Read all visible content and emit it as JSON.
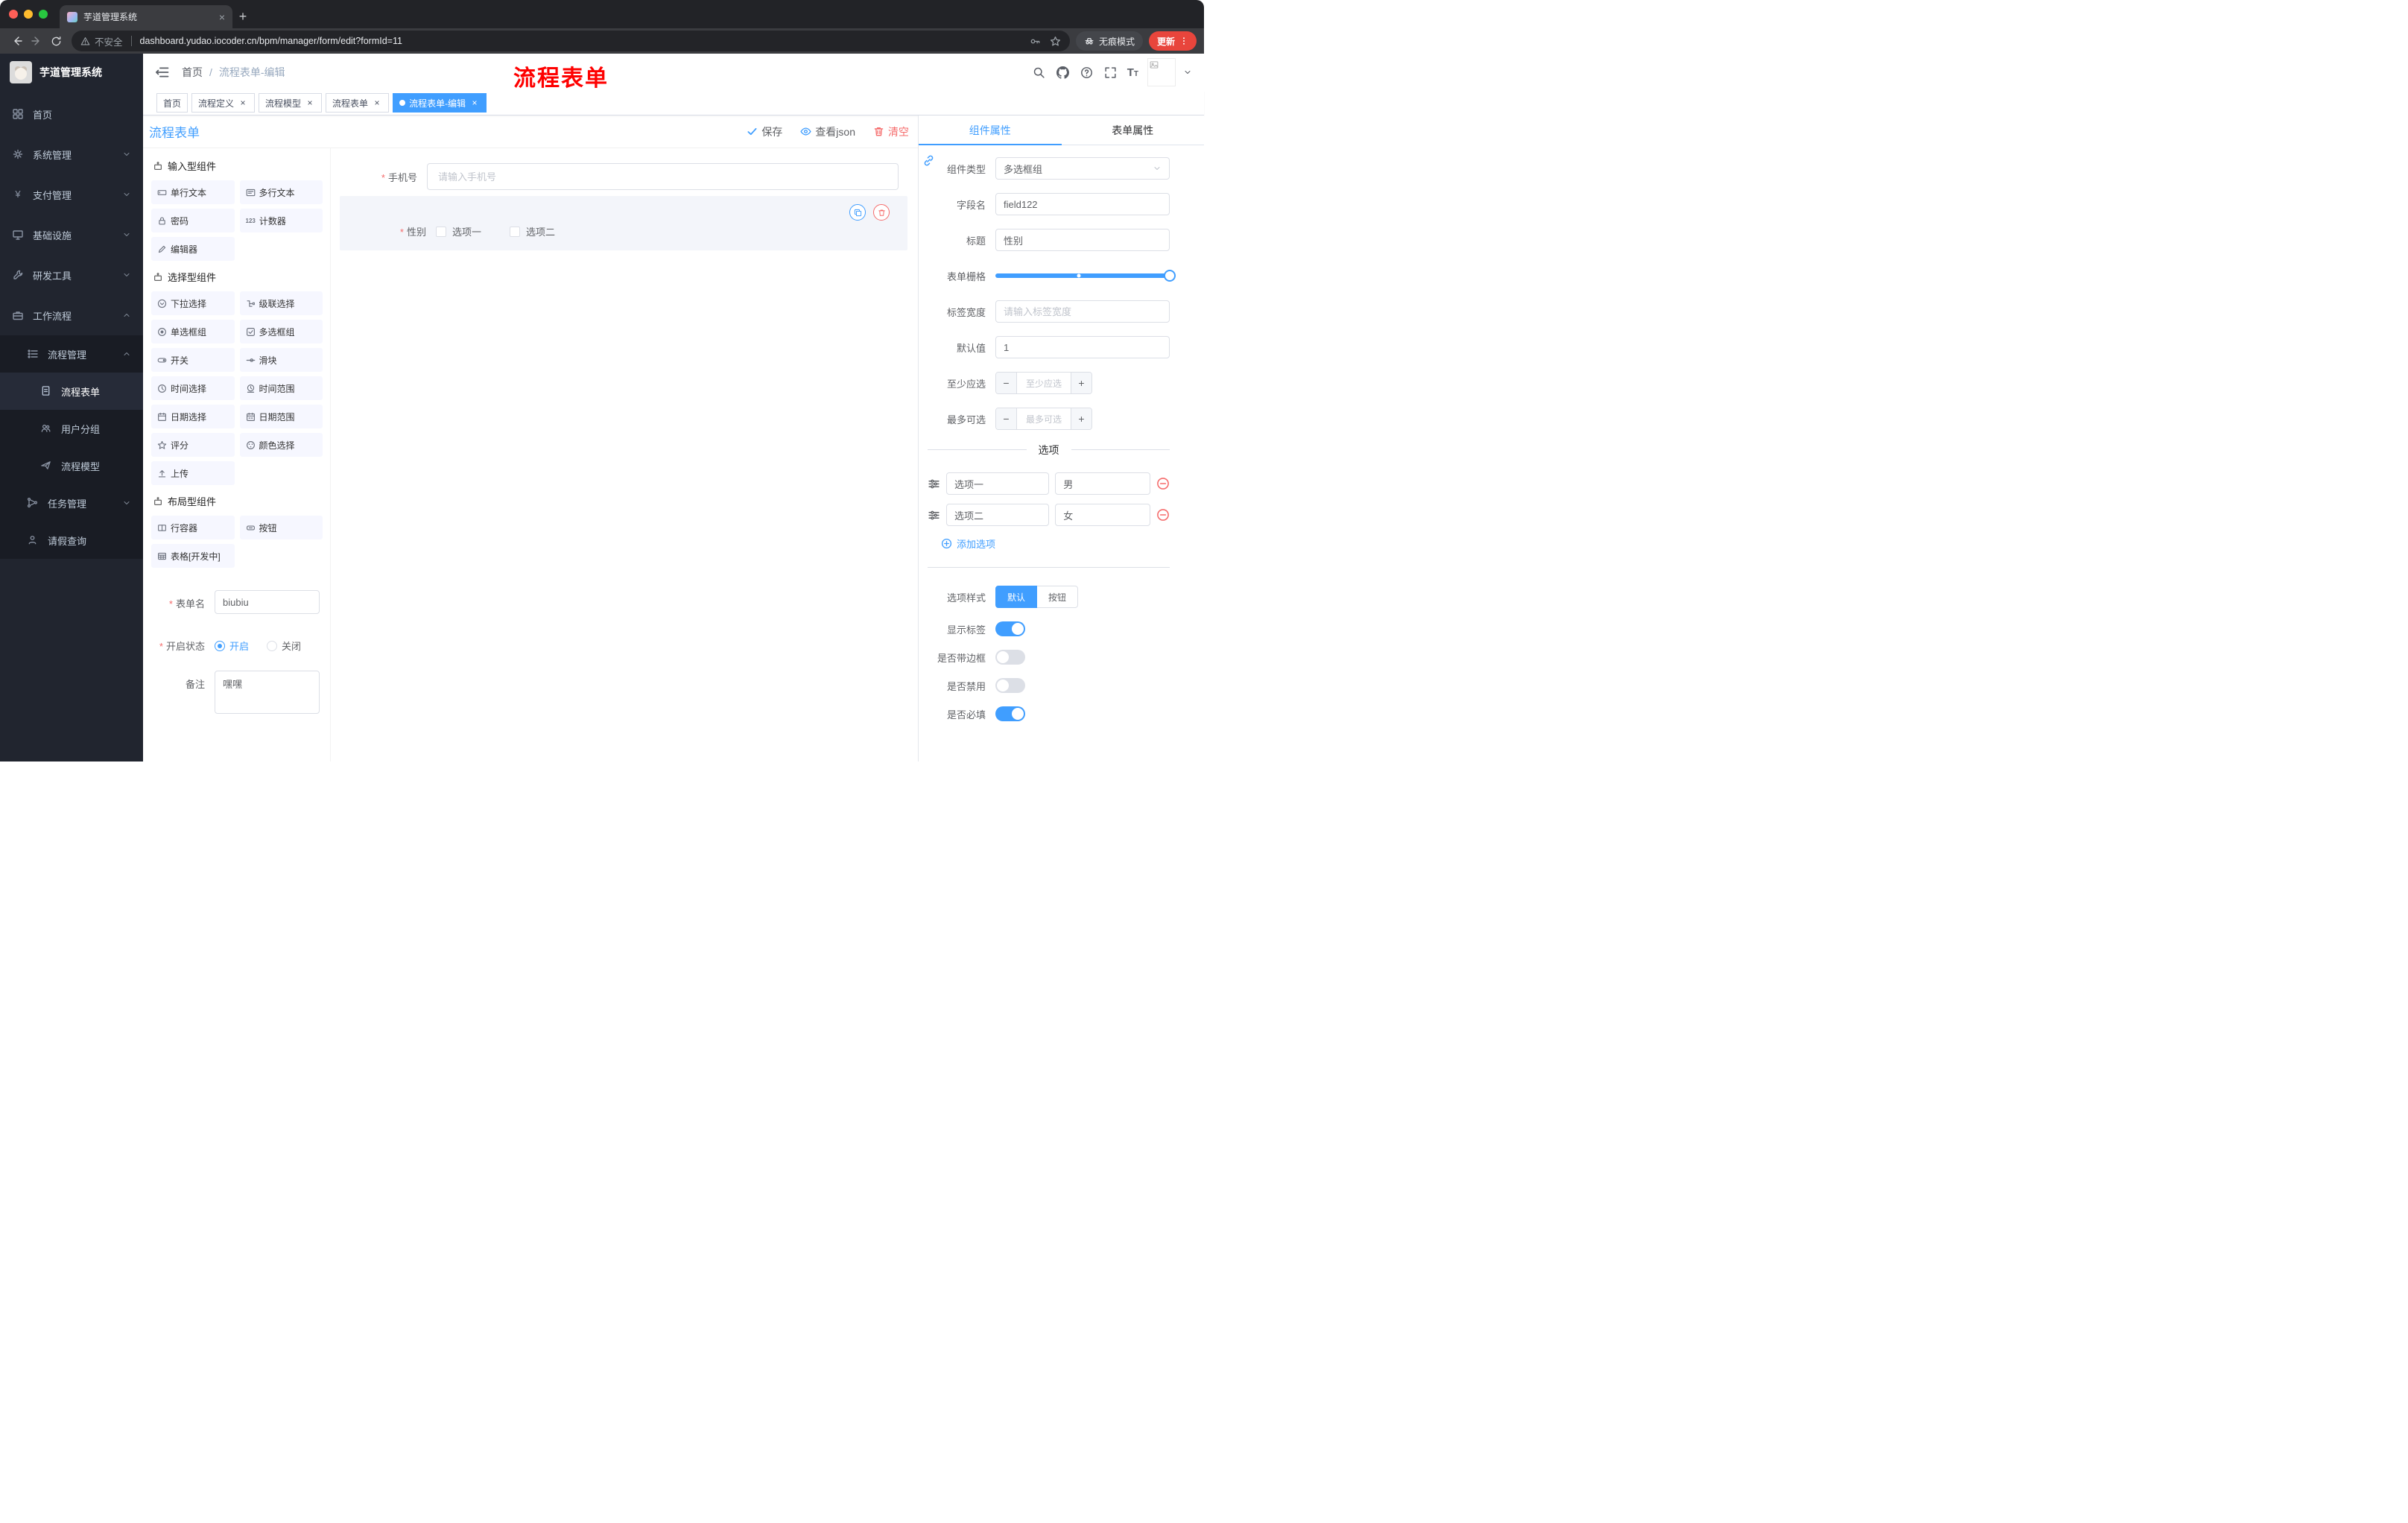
{
  "colors": {
    "accent": "#409eff",
    "danger": "#f56c6c",
    "annotation_red": "#fe0000",
    "active_tag": "#409eff",
    "sidebar_bg": "#21252f",
    "update_chip": "#e8453c"
  },
  "browser": {
    "tab_title": "芋道管理系统",
    "security_label": "不安全",
    "url": "dashboard.yudao.iocoder.cn/bpm/manager/form/edit?formId=11",
    "incognito_label": "无痕模式",
    "update_label": "更新"
  },
  "sidebar": {
    "logo_title": "芋道管理系统",
    "items": [
      {
        "label": "首页"
      },
      {
        "label": "系统管理"
      },
      {
        "label": "支付管理"
      },
      {
        "label": "基础设施"
      },
      {
        "label": "研发工具"
      },
      {
        "label": "工作流程"
      },
      {
        "label": "流程管理"
      },
      {
        "label": "流程表单"
      },
      {
        "label": "用户分组"
      },
      {
        "label": "流程模型"
      },
      {
        "label": "任务管理"
      },
      {
        "label": "请假查询"
      }
    ]
  },
  "navbar": {
    "breadcrumb_home": "首页",
    "breadcrumb_current": "流程表单-编辑",
    "annotation": "流程表单"
  },
  "tags": [
    {
      "label": "首页"
    },
    {
      "label": "流程定义"
    },
    {
      "label": "流程模型"
    },
    {
      "label": "流程表单"
    },
    {
      "label": "流程表单-编辑"
    }
  ],
  "designer": {
    "title": "流程表单",
    "actions": {
      "save": "保存",
      "view_json": "查看json",
      "clear": "清空"
    },
    "component_groups": [
      {
        "title": "输入型组件",
        "items": [
          "单行文本",
          "多行文本",
          "密码",
          "计数器",
          "编辑器"
        ]
      },
      {
        "title": "选择型组件",
        "items": [
          "下拉选择",
          "级联选择",
          "单选框组",
          "多选框组",
          "开关",
          "滑块",
          "时间选择",
          "时间范围",
          "日期选择",
          "日期范围",
          "评分",
          "颜色选择",
          "上传"
        ]
      },
      {
        "title": "布局型组件",
        "items": [
          "行容器",
          "按钮",
          "表格[开发中]"
        ]
      }
    ],
    "meta_form": {
      "form_name_label": "表单名",
      "form_name_value": "biubiu",
      "status_label": "开启状态",
      "status_on": "开启",
      "status_off": "关闭",
      "remark_label": "备注",
      "remark_value": "嘿嘿"
    },
    "canvas": {
      "phone_label": "手机号",
      "phone_placeholder": "请输入手机号",
      "gender_label": "性别",
      "gender_options": [
        "选项一",
        "选项二"
      ]
    }
  },
  "properties": {
    "tab_component": "组件属性",
    "tab_form": "表单属性",
    "component_type_label": "组件类型",
    "component_type_value": "多选框组",
    "field_name_label": "字段名",
    "field_name_value": "field122",
    "title_label": "标题",
    "title_value": "性别",
    "grid_label": "表单栅格",
    "label_width_label": "标签宽度",
    "label_width_placeholder": "请输入标签宽度",
    "default_label": "默认值",
    "default_value": "1",
    "min_label": "至少应选",
    "min_placeholder": "至少应选",
    "max_label": "最多可选",
    "max_placeholder": "最多可选",
    "options_divider": "选项",
    "options": [
      {
        "name": "选项一",
        "value": "男"
      },
      {
        "name": "选项二",
        "value": "女"
      }
    ],
    "add_option_label": "添加选项",
    "option_style_label": "选项样式",
    "style_default": "默认",
    "style_button": "按钮",
    "toggle_show_label": "显示标签",
    "toggle_border": "是否带边框",
    "toggle_disabled": "是否禁用",
    "toggle_required": "是否必填"
  }
}
